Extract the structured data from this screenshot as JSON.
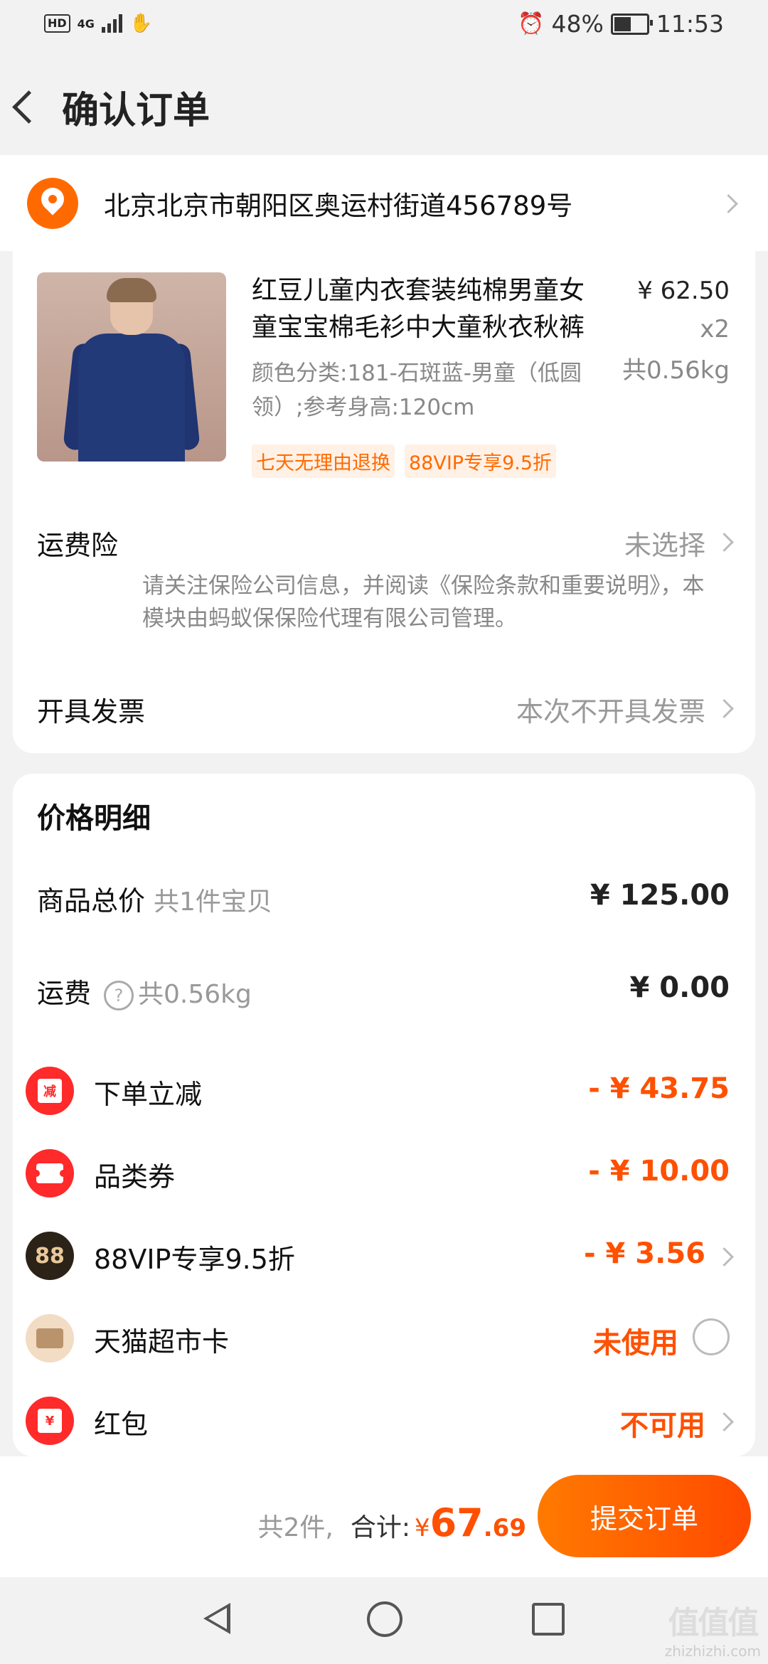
{
  "status": {
    "network": "4G",
    "battery": "48%",
    "time": "11:53",
    "battery_level": 0.48
  },
  "header": {
    "title": "确认订单"
  },
  "address": {
    "text": "北京北京市朝阳区奥运村街道456789号"
  },
  "product": {
    "title": "红豆儿童内衣套装纯棉男童女童宝宝棉毛衫中大童秋衣秋裤",
    "spec": "颜色分类:181-石斑蓝-男童（低圆领）;参考身高:120cm",
    "price": "¥ 62.50",
    "qty": "x2",
    "weight": "共0.56kg",
    "tags": [
      "七天无理由退换",
      "88VIP专享9.5折"
    ]
  },
  "insurance": {
    "label": "运费险",
    "value": "未选择",
    "note": "请关注保险公司信息，并阅读《保险条款和重要说明》，本模块由蚂蚁保保险代理有限公司管理。"
  },
  "invoice": {
    "label": "开具发票",
    "value": "本次不开具发票"
  },
  "price_detail": {
    "title": "价格明细",
    "goods_total_label": "商品总价",
    "goods_total_note": "共1件宝贝",
    "goods_total": "¥ 125.00",
    "shipping_label": "运费",
    "shipping_note": "共0.56kg",
    "shipping_help": "?",
    "shipping": "¥ 0.00",
    "discounts": [
      {
        "label": "下单立减",
        "amount": "- ¥ 43.75",
        "icon_text": "减"
      },
      {
        "label": "品类券",
        "amount": "- ¥ 10.00"
      },
      {
        "label": "88VIP专享9.5折",
        "amount": "- ¥ 3.56",
        "icon_text": "88"
      },
      {
        "label": "天猫超市卡",
        "amount": "未使用"
      },
      {
        "label": "红包",
        "amount": "不可用",
        "icon_text": "¥"
      }
    ]
  },
  "footer": {
    "count": "共2件,",
    "total_label": "合计:",
    "currency": "¥",
    "total_int": "67",
    "total_dec": ".69",
    "submit": "提交订单"
  },
  "watermark": {
    "logo": "值值值",
    "site": "zhizhizhi.com"
  }
}
